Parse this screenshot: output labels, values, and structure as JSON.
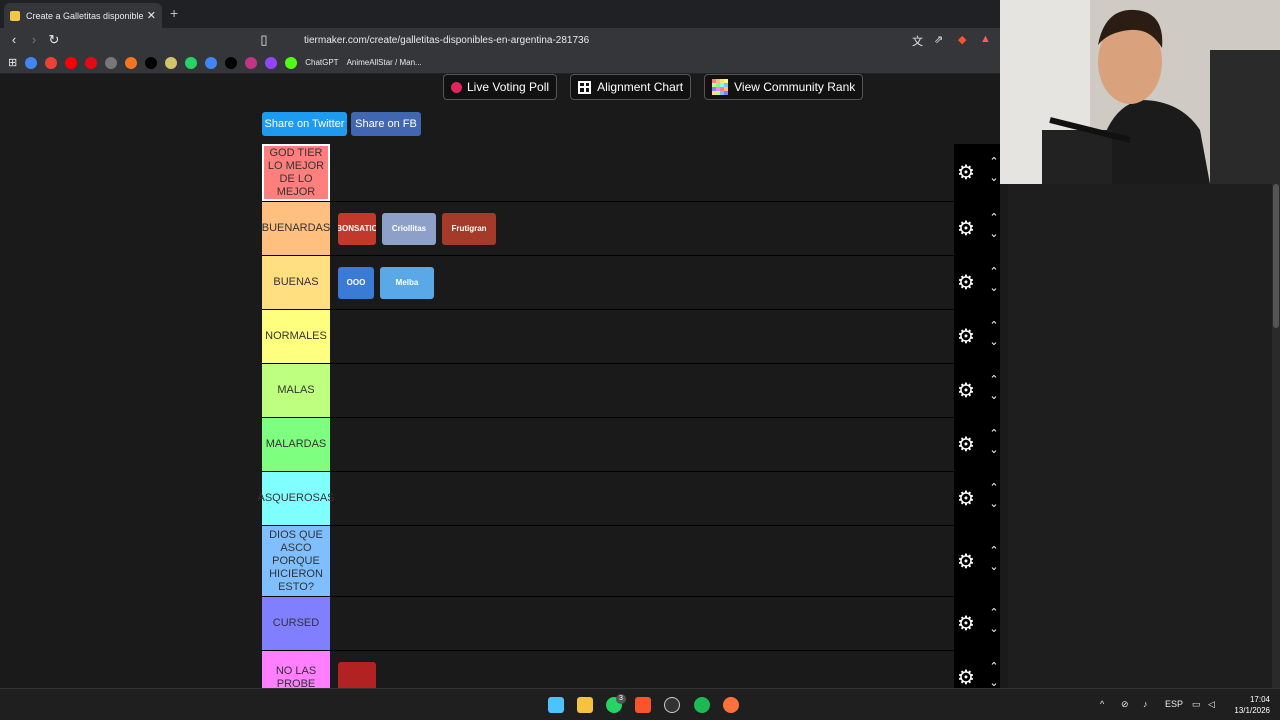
{
  "browser": {
    "tab_title": "Create a Galletitas disponibles e...",
    "tab_close": "✕",
    "new_tab": "+",
    "url": "tiermaker.com/create/galletitas-disponibles-en-argentina-281736",
    "bookmarks": [
      {
        "icon": "google-icon",
        "color": "#4285f4"
      },
      {
        "icon": "gmail-icon",
        "color": "#ea4335"
      },
      {
        "icon": "youtube-icon",
        "color": "#ff0000"
      },
      {
        "icon": "netflix-icon",
        "color": "#e50914"
      },
      {
        "icon": "bookmark-icon",
        "color": "#777"
      },
      {
        "icon": "crunchyroll-icon",
        "color": "#f47521"
      },
      {
        "icon": "tiktok-icon",
        "color": "#000000"
      },
      {
        "icon": "bookmark-icon-2",
        "color": "#d4c46a"
      },
      {
        "icon": "whatsapp-icon",
        "color": "#25d366"
      },
      {
        "icon": "translate-icon",
        "color": "#4285f4"
      },
      {
        "icon": "x-icon",
        "color": "#000000"
      },
      {
        "icon": "instagram-icon",
        "color": "#c13584"
      },
      {
        "icon": "twitch-icon",
        "color": "#9146ff"
      },
      {
        "icon": "kick-icon",
        "color": "#53fc18"
      }
    ],
    "bookmark_chatgpt": "ChatGPT",
    "bookmark_anime": "AnimeAllStar / Man..."
  },
  "page": {
    "live_voting": "Live Voting Poll",
    "alignment_chart": "Alignment Chart",
    "community_rank": "View Community Rank",
    "share_twitter": "Share on Twitter",
    "share_fb": "Share on FB"
  },
  "tiers": [
    {
      "label": "GOD TIER LO MEJOR DE LO MEJOR",
      "color": "#ff7f7f",
      "items": []
    },
    {
      "label": "BUENARDAS",
      "color": "#ffbf7f",
      "items": [
        {
          "name": "bonsatio-cookie",
          "text": "BONSATIO",
          "color": "#c0392b",
          "w": 38
        },
        {
          "name": "criollitas-cookie",
          "text": "Criollitas",
          "color": "#8ea0c8",
          "w": 54
        },
        {
          "name": "frutigran-cookie",
          "text": "Frutigran",
          "color": "#a33a2a",
          "w": 54
        }
      ]
    },
    {
      "label": "BUENAS",
      "color": "#ffdf7f",
      "items": [
        {
          "name": "sonrisas-cookie",
          "text": "OOO",
          "color": "#3a7bd5",
          "w": 36
        },
        {
          "name": "mellizas-cookie",
          "text": "Melba",
          "color": "#5aa9e6",
          "w": 54
        }
      ]
    },
    {
      "label": "NORMALES",
      "color": "#ffff7f",
      "items": []
    },
    {
      "label": "MALAS",
      "color": "#bfff7f",
      "items": []
    },
    {
      "label": "MALARDAS",
      "color": "#7fff7f",
      "items": []
    },
    {
      "label": "ASQUEROSAS",
      "color": "#7fffff",
      "items": []
    },
    {
      "label": "DIOS QUE ASCO PORQUE HICIERON ESTO?",
      "color": "#7fbfff",
      "items": []
    },
    {
      "label": "CURSED",
      "color": "#7f7fff",
      "items": []
    },
    {
      "label": "NO LAS PROBE",
      "color": "#ff7fff",
      "items": [
        {
          "name": "pepitos-cookie",
          "text": "",
          "color": "#b22222",
          "w": 38
        }
      ]
    }
  ],
  "taskbar": {
    "lang": "ESP",
    "time": "17:04",
    "date": "13/1/2026",
    "whatsapp_badge": "3"
  }
}
